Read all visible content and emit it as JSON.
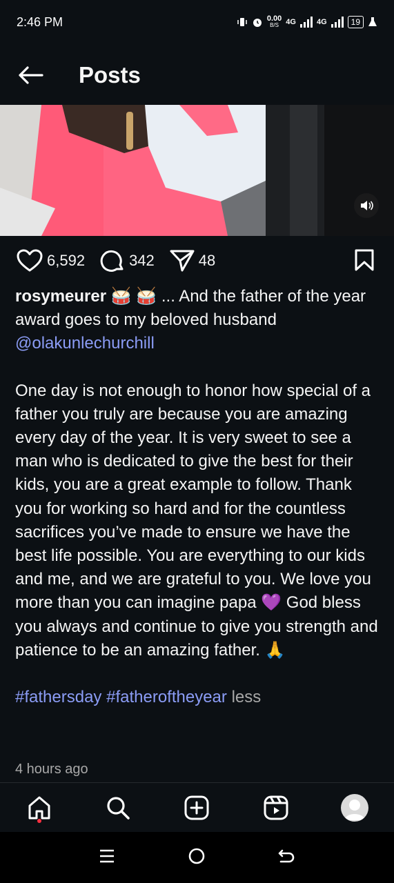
{
  "status_bar": {
    "time": "2:46 PM",
    "data_rate": "0.00",
    "data_unit": "B/S",
    "net1": "4G",
    "net2": "4G",
    "battery": "19"
  },
  "header": {
    "title": "Posts",
    "back_icon": "arrow-left-icon"
  },
  "media": {
    "volume_icon": "speaker-icon"
  },
  "actions": {
    "likes": "6,592",
    "comments": "342",
    "shares": "48"
  },
  "caption": {
    "username": "rosymeurer",
    "emoji1": "🥁 🥁",
    "line1_rest": " ... And the father of the year award goes to my beloved husband ",
    "mention": "@olakunlechurchill",
    "body": "One day is not enough to honor how special of a father you truly are because you are amazing every day of the year. It is very sweet to see a man who is dedicated to give the best for their kids, you are a great example to follow. Thank you for working so hard and for the countless sacrifices you’ve made to ensure we have the best life possible. You are everything to our kids and me, and we are grateful to you. We love you more than you can imagine papa 💜 God bless you always and continue to give you strength and patience to be an amazing father. 🙏",
    "hashtag1": "#fathersday",
    "hashtag2": "#fatheroftheyear",
    "less": "less",
    "time_ago": "4 hours ago"
  },
  "colors": {
    "background": "#0c1014",
    "link": "#8b9cf5",
    "muted": "#a8a8a8",
    "notification_dot": "#ff3040"
  },
  "bottom_nav": [
    "home-icon",
    "search-icon",
    "create-icon",
    "reels-icon",
    "profile-avatar"
  ],
  "system_nav": [
    "recents-icon",
    "home-circle-icon",
    "back-icon"
  ]
}
